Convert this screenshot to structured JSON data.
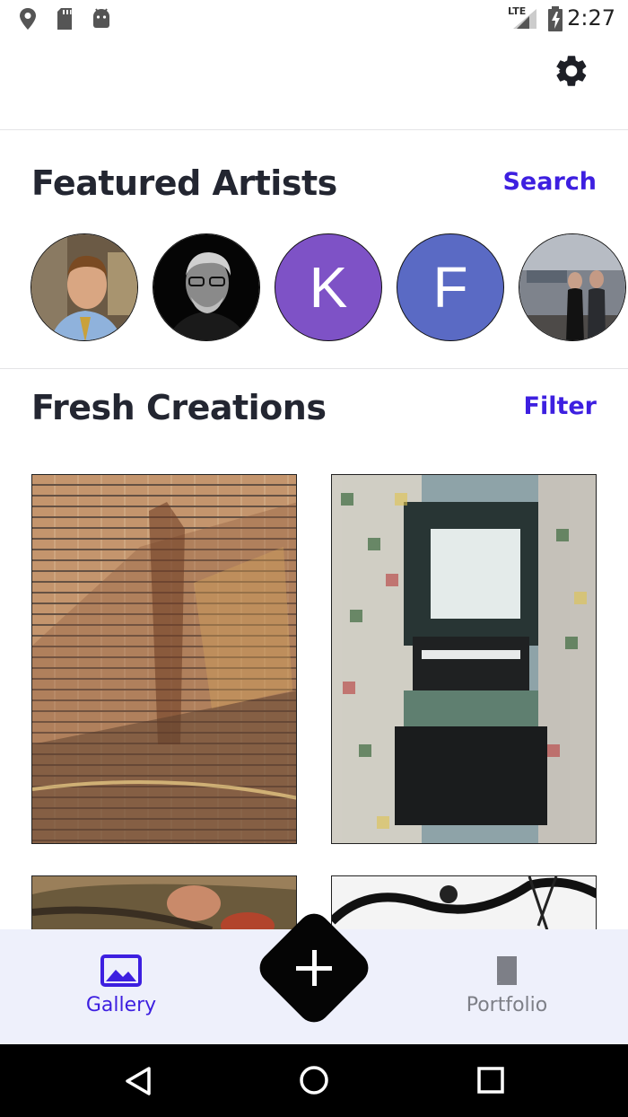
{
  "status_bar": {
    "time": "2:27",
    "network": "LTE",
    "icons": [
      "location-icon",
      "sd-card-icon",
      "android-icon",
      "signal-icon",
      "battery-charging-icon"
    ]
  },
  "app_bar": {
    "settings_icon": "gear-icon"
  },
  "featured": {
    "title": "Featured Artists",
    "action": "Search",
    "artists": [
      {
        "type": "photo",
        "icon": "artist-photo-1"
      },
      {
        "type": "photo",
        "icon": "artist-photo-2"
      },
      {
        "type": "letter",
        "letter": "K",
        "color": "#7e52c6"
      },
      {
        "type": "letter",
        "letter": "F",
        "color": "#5a6ac4"
      },
      {
        "type": "photo",
        "icon": "artist-photo-5"
      }
    ]
  },
  "fresh": {
    "title": "Fresh Creations",
    "action": "Filter"
  },
  "bottom_nav": {
    "gallery_label": "Gallery",
    "portfolio_label": "Portfolio",
    "active": "Gallery",
    "active_color": "#3d1fe0",
    "inactive_color": "#7d7f87"
  },
  "colors": {
    "accent": "#3d1fe0",
    "title": "#232631"
  }
}
